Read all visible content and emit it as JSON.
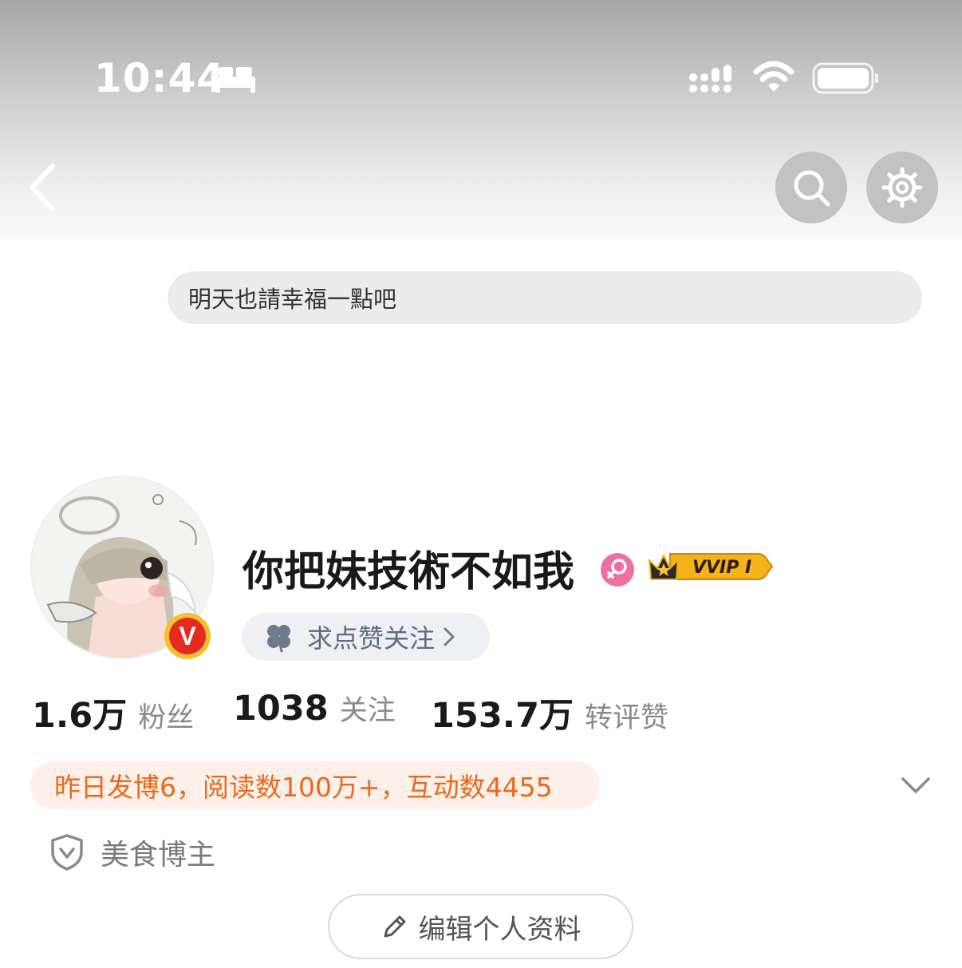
{
  "status_bar": {
    "time": "10:44",
    "icons": [
      "bed-icon",
      "cellular-signal-icon",
      "wifi-icon",
      "battery-icon"
    ]
  },
  "nav": {
    "back_icon": "chevron-left-icon",
    "search_icon": "search-icon",
    "settings_icon": "gear-icon"
  },
  "profile": {
    "signature": "明天也請幸福一點吧",
    "name": "你把妹技術不如我",
    "gender_icon": "female-icon",
    "vip_badge": "VVIP I",
    "verified_badge": "V",
    "like_follow_label": "求点赞关注",
    "like_follow_icon": "clover-icon"
  },
  "stats": [
    {
      "value": "1.6万",
      "label": "粉丝"
    },
    {
      "value": "1038",
      "label": "关注"
    },
    {
      "value": "153.7万",
      "label": "转评赞"
    }
  ],
  "activity": "昨日发博6，阅读数100万+，互动数4455",
  "tag": {
    "icon": "shield-check-icon",
    "label": "美食博主"
  },
  "edit_profile": {
    "icon": "pencil-icon",
    "label": "编辑个人资料"
  },
  "colors": {
    "accent_orange": "#e86a1e",
    "activity_bg": "#fdf0e8",
    "verified_red": "#e52b1f",
    "verified_gold": "#f2c12e",
    "vip_gold": "#f5b31a",
    "chip_text": "#5e6b82",
    "gender_pink": "#ee6fa1"
  }
}
